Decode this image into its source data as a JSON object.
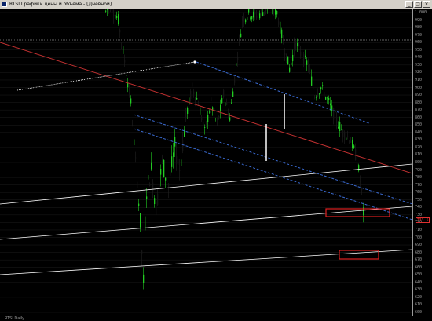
{
  "window": {
    "title": "RTSI Графики цены и объема - [Дневной]",
    "buttons": [
      "_",
      "□",
      "×"
    ]
  },
  "chart_data": {
    "type": "candlestick",
    "y_ticks": [
      1000,
      990,
      980,
      970,
      960,
      950,
      940,
      930,
      920,
      910,
      900,
      890,
      880,
      870,
      860,
      850,
      840,
      830,
      820,
      810,
      800,
      790,
      780,
      770,
      760,
      750,
      740,
      730,
      720,
      710,
      700,
      690,
      680,
      670,
      660,
      650,
      640,
      630,
      620,
      610,
      600
    ],
    "current_price_label": "733.5",
    "colors": {
      "up": "#22cc22",
      "down": "#111111",
      "trendline_red": "#c03030",
      "trendline_blue": "#3a6ad0",
      "white": "#ffffff",
      "highlight_box": "#e02020"
    }
  },
  "footer": {
    "label": "RTSI Daily"
  }
}
